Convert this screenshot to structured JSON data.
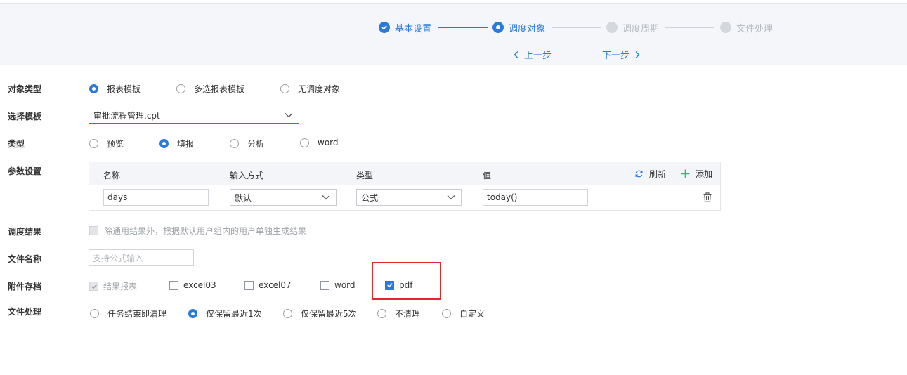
{
  "steps": [
    {
      "label": "基本设置",
      "state": "done"
    },
    {
      "label": "调度对象",
      "state": "current"
    },
    {
      "label": "调度周期",
      "state": "todo"
    },
    {
      "label": "文件处理",
      "state": "todo"
    }
  ],
  "nav": {
    "prev": "上一步",
    "next": "下一步"
  },
  "object_type": {
    "label": "对象类型",
    "options": [
      "报表模板",
      "多选报表模板",
      "无调度对象"
    ],
    "selected": "报表模板"
  },
  "template": {
    "label": "选择模板",
    "value": "审批流程管理.cpt"
  },
  "type": {
    "label": "类型",
    "options": [
      "预览",
      "填报",
      "分析",
      "word"
    ],
    "selected": "填报"
  },
  "params": {
    "label": "参数设置",
    "headers": [
      "名称",
      "输入方式",
      "类型",
      "值"
    ],
    "refresh": "刷新",
    "add": "添加",
    "rows": [
      {
        "name": "days",
        "input_mode": "默认",
        "type": "公式",
        "value": "today()"
      }
    ]
  },
  "result": {
    "label": "调度结果",
    "checkbox_text": "除通用结果外，根据默认用户组内的用户单独生成结果"
  },
  "filename": {
    "label": "文件名称",
    "placeholder": "支持公式输入"
  },
  "attachments": {
    "label": "附件存档",
    "options": [
      {
        "text": "结果报表",
        "checked": true,
        "disabled": true
      },
      {
        "text": "excel03",
        "checked": false,
        "disabled": false
      },
      {
        "text": "excel07",
        "checked": false,
        "disabled": false
      },
      {
        "text": "word",
        "checked": false,
        "disabled": false
      },
      {
        "text": "pdf",
        "checked": true,
        "disabled": false
      }
    ]
  },
  "file_processing": {
    "label": "文件处理",
    "options": [
      "任务结束即清理",
      "仅保留最近1次",
      "仅保留最近5次",
      "不清理",
      "自定义"
    ],
    "selected": "仅保留最近1次"
  },
  "colors": {
    "accent": "#2a7ade",
    "highlight": "#e0282e"
  }
}
